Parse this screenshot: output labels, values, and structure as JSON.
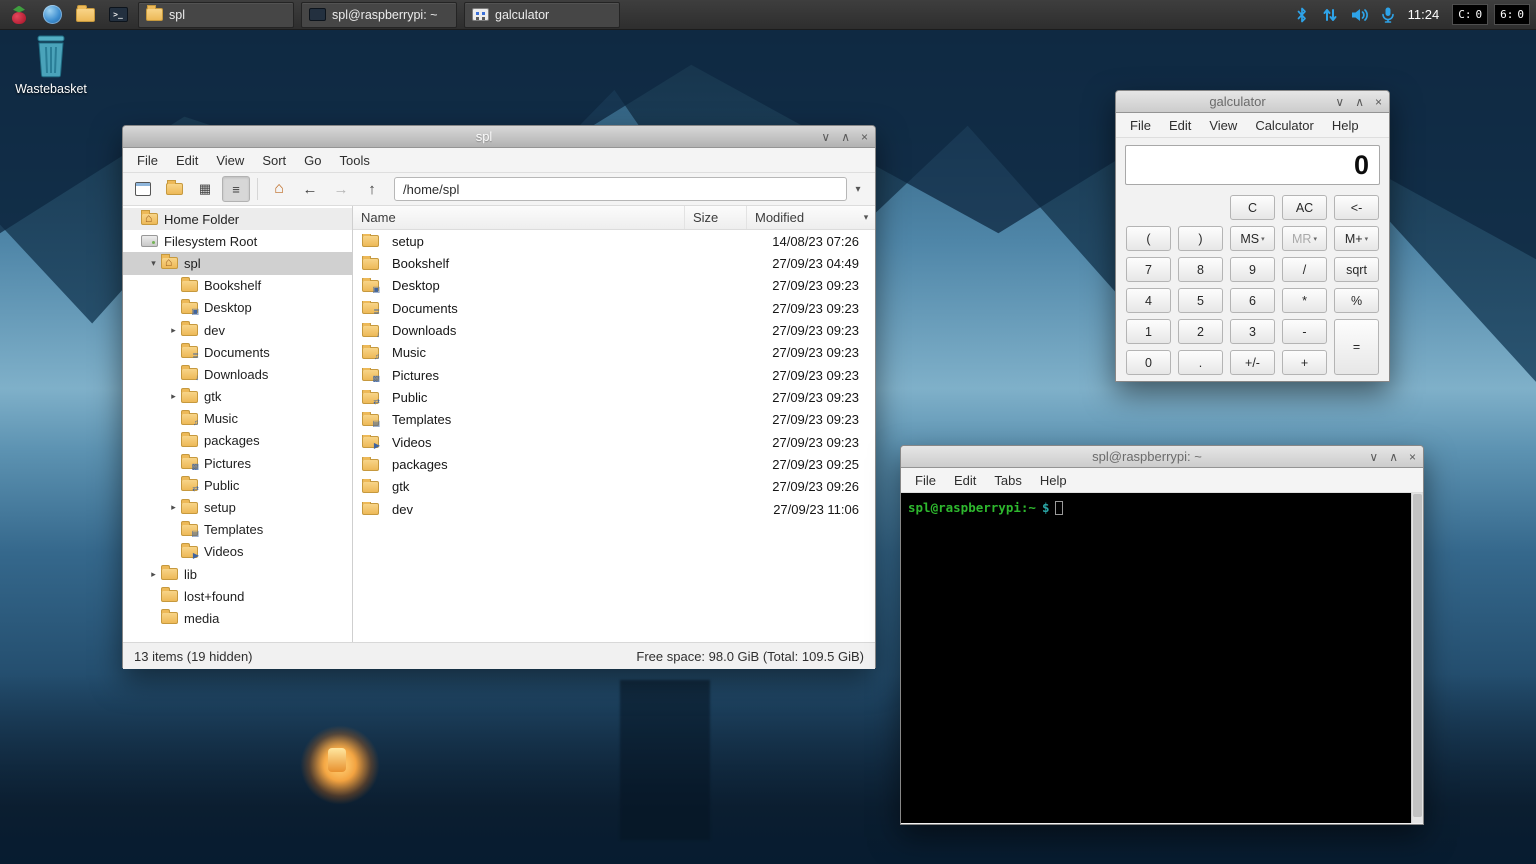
{
  "icons": {
    "minimize": "∨",
    "maximize": "∧",
    "close": "×",
    "back": "←",
    "forward": "→",
    "up": "↑",
    "home": "⌂",
    "icon_view": "▦",
    "list_view": "≡",
    "dropdown": "▾",
    "terminal_prompt_glyph": ">_"
  },
  "taskbar": {
    "clock": "11:24",
    "windows": [
      {
        "icon": "fm",
        "label": "spl"
      },
      {
        "icon": "term",
        "label": "spl@raspberrypi: ~"
      },
      {
        "icon": "calc",
        "label": "galculator"
      }
    ],
    "indicators": [
      {
        "label": "C:",
        "value": "0"
      },
      {
        "label": "6:",
        "value": "0"
      }
    ]
  },
  "desktop": {
    "wastebasket_label": "Wastebasket"
  },
  "file_manager": {
    "title": "spl",
    "menu": [
      "File",
      "Edit",
      "View",
      "Sort",
      "Go",
      "Tools"
    ],
    "path": "/home/spl",
    "columns": {
      "name": "Name",
      "size": "Size",
      "modified": "Modified"
    },
    "sidebar": [
      {
        "label": "Home Folder",
        "icon": "home",
        "depth": 0,
        "header": true
      },
      {
        "label": "Filesystem Root",
        "icon": "drive",
        "depth": 0
      },
      {
        "label": "spl",
        "icon": "home",
        "depth": 1,
        "expander": "open",
        "selected": true
      },
      {
        "label": "Bookshelf",
        "icon": "folder",
        "depth": 2
      },
      {
        "label": "Desktop",
        "icon": "folder",
        "emblem": "▣",
        "depth": 2
      },
      {
        "label": "dev",
        "icon": "folder",
        "depth": 2,
        "expander": "closed"
      },
      {
        "label": "Documents",
        "icon": "folder",
        "emblem": "≣",
        "depth": 2
      },
      {
        "label": "Downloads",
        "icon": "folder",
        "emblem": "↓",
        "depth": 2
      },
      {
        "label": "gtk",
        "icon": "folder",
        "depth": 2,
        "expander": "closed"
      },
      {
        "label": "Music",
        "icon": "folder",
        "emblem": "♫",
        "depth": 2
      },
      {
        "label": "packages",
        "icon": "folder",
        "depth": 2
      },
      {
        "label": "Pictures",
        "icon": "folder",
        "emblem": "▩",
        "depth": 2
      },
      {
        "label": "Public",
        "icon": "folder",
        "emblem": "⇄",
        "depth": 2
      },
      {
        "label": "setup",
        "icon": "folder",
        "depth": 2,
        "expander": "closed"
      },
      {
        "label": "Templates",
        "icon": "folder",
        "emblem": "▤",
        "depth": 2
      },
      {
        "label": "Videos",
        "icon": "folder",
        "emblem": "▶",
        "depth": 2
      },
      {
        "label": "lib",
        "icon": "folder",
        "depth": 1,
        "expander": "closed"
      },
      {
        "label": "lost+found",
        "icon": "folder",
        "depth": 1
      },
      {
        "label": "media",
        "icon": "folder",
        "depth": 1
      }
    ],
    "files": [
      {
        "name": "setup",
        "size": "",
        "modified": "14/08/23 07:26"
      },
      {
        "name": "Bookshelf",
        "size": "",
        "modified": "27/09/23 04:49"
      },
      {
        "name": "Desktop",
        "emblem": "▣",
        "size": "",
        "modified": "27/09/23 09:23"
      },
      {
        "name": "Documents",
        "emblem": "≣",
        "size": "",
        "modified": "27/09/23 09:23"
      },
      {
        "name": "Downloads",
        "emblem": "↓",
        "size": "",
        "modified": "27/09/23 09:23"
      },
      {
        "name": "Music",
        "emblem": "♫",
        "size": "",
        "modified": "27/09/23 09:23"
      },
      {
        "name": "Pictures",
        "emblem": "▩",
        "size": "",
        "modified": "27/09/23 09:23"
      },
      {
        "name": "Public",
        "emblem": "⇄",
        "size": "",
        "modified": "27/09/23 09:23"
      },
      {
        "name": "Templates",
        "emblem": "▤",
        "size": "",
        "modified": "27/09/23 09:23"
      },
      {
        "name": "Videos",
        "emblem": "▶",
        "size": "",
        "modified": "27/09/23 09:23"
      },
      {
        "name": "packages",
        "size": "",
        "modified": "27/09/23 09:25"
      },
      {
        "name": "gtk",
        "size": "",
        "modified": "27/09/23 09:26"
      },
      {
        "name": "dev",
        "size": "",
        "modified": "27/09/23 11:06"
      }
    ],
    "status_left": "13 items (19 hidden)",
    "status_right": "Free space: 98.0 GiB (Total: 109.5 GiB)"
  },
  "terminal": {
    "title": "spl@raspberrypi: ~",
    "menu": [
      "File",
      "Edit",
      "Tabs",
      "Help"
    ],
    "prompt_user": "spl@raspberrypi:~",
    "prompt_symbol": "$"
  },
  "calculator": {
    "title": "galculator",
    "menu": [
      "File",
      "Edit",
      "View",
      "Calculator",
      "Help"
    ],
    "display_value": "0",
    "buttons": [
      {
        "label": "C",
        "row": 1,
        "col": 3
      },
      {
        "label": "AC",
        "row": 1,
        "col": 4
      },
      {
        "label": "<-",
        "row": 1,
        "col": 5
      },
      {
        "label": "(",
        "row": 2,
        "col": 1
      },
      {
        "label": ")",
        "row": 2,
        "col": 2
      },
      {
        "label": "MS",
        "row": 2,
        "col": 3,
        "dropdown": true
      },
      {
        "label": "MR",
        "row": 2,
        "col": 4,
        "dropdown": true,
        "disabled": true
      },
      {
        "label": "M+",
        "row": 2,
        "col": 5,
        "dropdown": true
      },
      {
        "label": "7",
        "row": 3,
        "col": 1
      },
      {
        "label": "8",
        "row": 3,
        "col": 2
      },
      {
        "label": "9",
        "row": 3,
        "col": 3
      },
      {
        "label": "/",
        "row": 3,
        "col": 4
      },
      {
        "label": "sqrt",
        "row": 3,
        "col": 5
      },
      {
        "label": "4",
        "row": 4,
        "col": 1
      },
      {
        "label": "5",
        "row": 4,
        "col": 2
      },
      {
        "label": "6",
        "row": 4,
        "col": 3
      },
      {
        "label": "*",
        "row": 4,
        "col": 4
      },
      {
        "label": "%",
        "row": 4,
        "col": 5
      },
      {
        "label": "1",
        "row": 5,
        "col": 1
      },
      {
        "label": "2",
        "row": 5,
        "col": 2
      },
      {
        "label": "3",
        "row": 5,
        "col": 3
      },
      {
        "label": "-",
        "row": 5,
        "col": 4
      },
      {
        "label": "=",
        "row": 5,
        "col": 5,
        "rowspan": 2
      },
      {
        "label": "0",
        "row": 6,
        "col": 1
      },
      {
        "label": ".",
        "row": 6,
        "col": 2
      },
      {
        "label": "+/-",
        "row": 6,
        "col": 3
      },
      {
        "label": "+",
        "row": 6,
        "col": 4
      }
    ]
  }
}
